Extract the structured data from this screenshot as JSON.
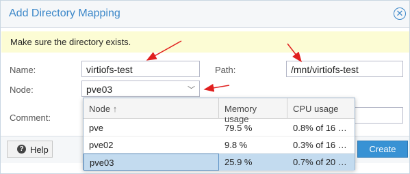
{
  "dialog": {
    "title": "Add Directory Mapping",
    "close_icon": "close-icon"
  },
  "notice": {
    "text": "Make sure the directory exists."
  },
  "form": {
    "name_label": "Name:",
    "name_value": "virtiofs-test",
    "path_label": "Path:",
    "path_value": "/mnt/virtiofs-test",
    "node_label": "Node:",
    "node_value": "pve03",
    "comment_label": "Comment:"
  },
  "dropdown": {
    "columns": [
      {
        "label": "Node",
        "sort_icon": "sort-arrow-up-icon"
      },
      {
        "label": "Memory usage"
      },
      {
        "label": "CPU usage"
      }
    ],
    "rows": [
      {
        "node": "pve",
        "memory": "79.5 %",
        "cpu": "0.8% of 16 …",
        "selected": false
      },
      {
        "node": "pve02",
        "memory": "9.8 %",
        "cpu": "0.3% of 16 …",
        "selected": false
      },
      {
        "node": "pve03",
        "memory": "25.9 %",
        "cpu": "0.7% of 20 …",
        "selected": true
      }
    ]
  },
  "footer": {
    "help_label": "Help",
    "create_label": "Create"
  },
  "colors": {
    "accent": "#3a86c8",
    "notice_bg": "#fcfcd4",
    "selected_row": "#c3dbef",
    "annotation_arrow": "#e0201f"
  }
}
